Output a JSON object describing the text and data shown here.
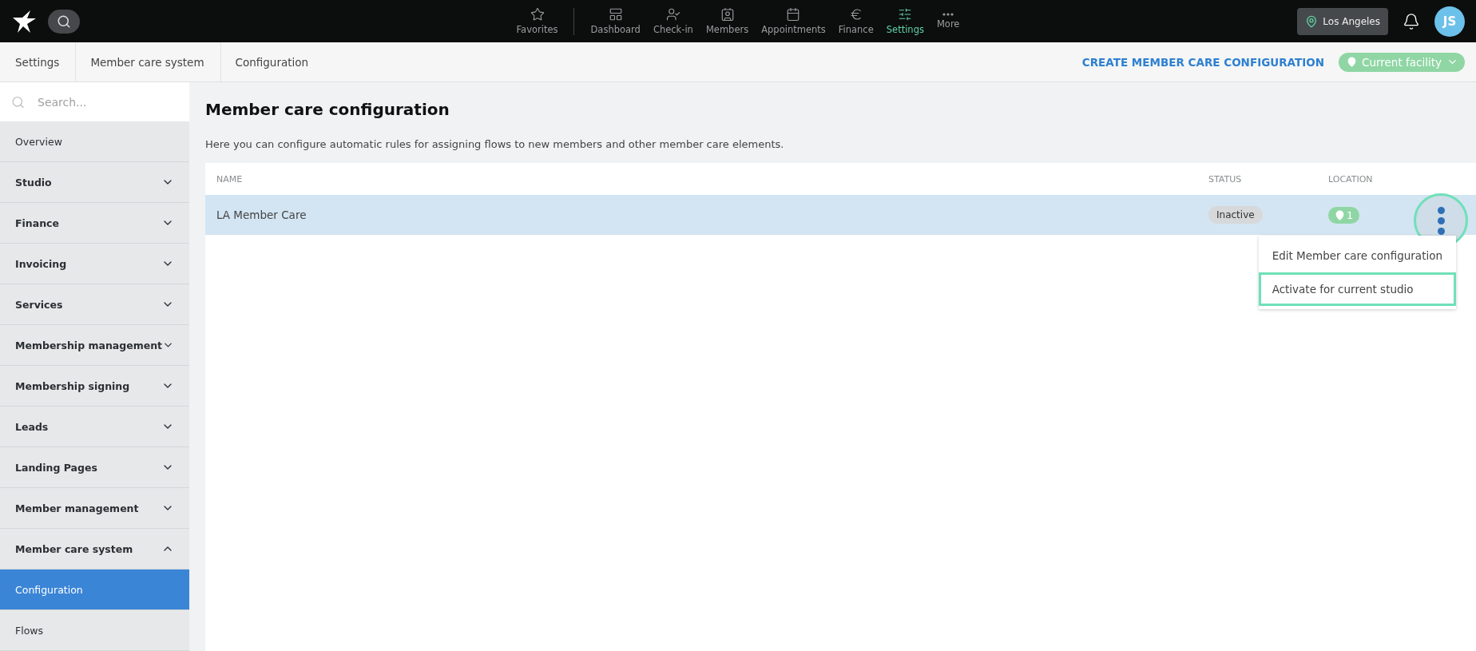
{
  "top_nav": {
    "items": [
      {
        "label": "Favorites",
        "kind": "favorites",
        "selected": false
      },
      {
        "label": "Dashboard",
        "kind": "dashboard",
        "selected": false
      },
      {
        "label": "Check-in",
        "kind": "checkin",
        "selected": false
      },
      {
        "label": "Members",
        "kind": "members",
        "selected": false
      },
      {
        "label": "Appointments",
        "kind": "appointments",
        "selected": false
      },
      {
        "label": "Finance",
        "kind": "finance",
        "selected": false
      },
      {
        "label": "Settings",
        "kind": "settings",
        "selected": true
      },
      {
        "label": "More",
        "kind": "more",
        "selected": false
      }
    ],
    "location": "Los Angeles",
    "avatar": "JS"
  },
  "breadcrumbs": [
    "Settings",
    "Member care system",
    "Configuration"
  ],
  "actions": {
    "create": "CREATE MEMBER CARE CONFIGURATION",
    "facility": "Current facility"
  },
  "sidebar": {
    "search_placeholder": "Search...",
    "items": [
      {
        "label": "Overview",
        "kind": "link",
        "selected": false
      },
      {
        "label": "Studio",
        "kind": "group",
        "expanded": false
      },
      {
        "label": "Finance",
        "kind": "group",
        "expanded": false
      },
      {
        "label": "Invoicing",
        "kind": "group",
        "expanded": false
      },
      {
        "label": "Services",
        "kind": "group",
        "expanded": false
      },
      {
        "label": "Membership management",
        "kind": "group",
        "expanded": false
      },
      {
        "label": "Membership signing",
        "kind": "group",
        "expanded": false
      },
      {
        "label": "Leads",
        "kind": "group",
        "expanded": false
      },
      {
        "label": "Landing Pages",
        "kind": "group",
        "expanded": false
      },
      {
        "label": "Member management",
        "kind": "group",
        "expanded": false
      },
      {
        "label": "Member care system",
        "kind": "group",
        "expanded": true
      },
      {
        "label": "Configuration",
        "kind": "link",
        "selected": true
      },
      {
        "label": "Flows",
        "kind": "link",
        "selected": false
      }
    ]
  },
  "page": {
    "title": "Member care configuration",
    "description": "Here you can configure automatic rules for assigning flows to new members and other member care elements."
  },
  "table": {
    "columns": [
      "NAME",
      "STATUS",
      "LOCATION"
    ],
    "rows": [
      {
        "name": "LA Member Care",
        "status": "Inactive",
        "location": "1",
        "selected": true
      }
    ]
  },
  "row_menu": {
    "items": [
      {
        "label": "Edit Member care configuration",
        "selected": false
      },
      {
        "label": "Activate for current studio",
        "selected": true
      }
    ]
  }
}
